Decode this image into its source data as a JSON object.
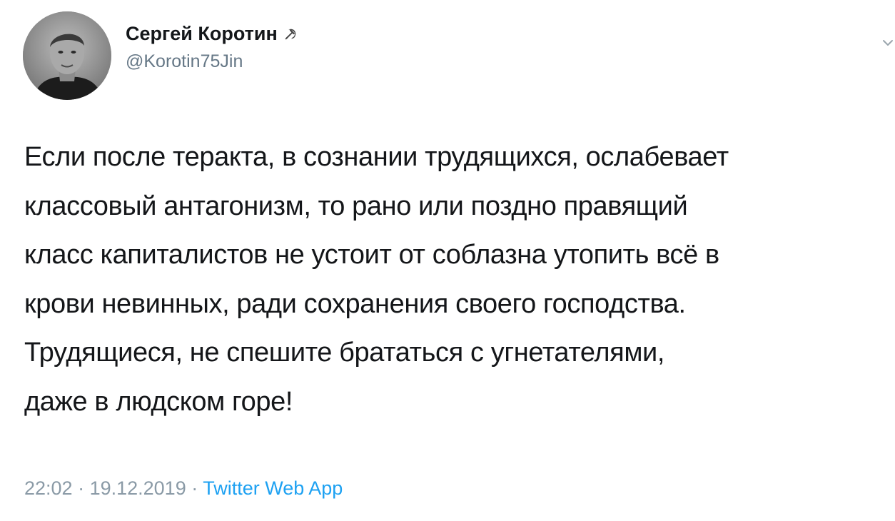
{
  "author": {
    "display_name": "Сергей Коротин",
    "badge_icon": "hammer-and-sickle-icon",
    "handle": "@Korotin75Jin"
  },
  "menu": {
    "icon": "chevron-down-icon"
  },
  "tweet": {
    "lines": [
      "Если после теракта, в сознании трудящихся, ослабевает",
      "классовый антагонизм, то рано или поздно правящий",
      "класс капиталистов не устоит от соблазна утопить всё в",
      "крови невинных, ради сохранения своего господства.",
      "Трудящиеся, не спешите брататься с угнетателями,",
      "даже в людском горе!"
    ]
  },
  "meta": {
    "time": "22:02",
    "separator": " · ",
    "date": "19.12.2019",
    "source": "Twitter Web App"
  },
  "colors": {
    "text": "#141619",
    "secondary": "#657786",
    "link": "#1da1f2"
  }
}
